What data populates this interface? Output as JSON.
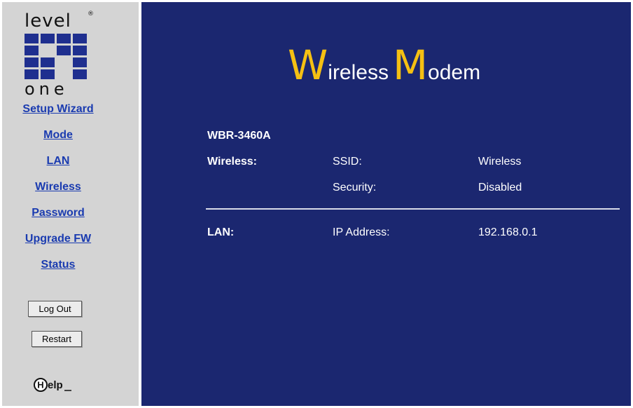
{
  "sidebar": {
    "logo": {
      "line1": "level",
      "registered": "®",
      "line2": "one"
    },
    "nav": [
      {
        "label": "Setup Wizard"
      },
      {
        "label": "Mode"
      },
      {
        "label": "LAN"
      },
      {
        "label": "Wireless"
      },
      {
        "label": "Password"
      },
      {
        "label": "Upgrade FW"
      },
      {
        "label": "Status"
      }
    ],
    "logout_label": "Log Out",
    "restart_label": "Restart",
    "help_label": "elp"
  },
  "main": {
    "title": {
      "w_cap": "W",
      "w_rest": "ireless",
      "m_cap": "M",
      "m_rest": "odem"
    },
    "model": "WBR-3460A",
    "wireless": {
      "label": "Wireless:",
      "ssid_label": "SSID:",
      "ssid_value": "Wireless",
      "security_label": "Security:",
      "security_value": "Disabled"
    },
    "lan": {
      "label": "LAN:",
      "ip_label": "IP Address:",
      "ip_value": "192.168.0.1"
    }
  },
  "colors": {
    "main_bg": "#1b2770",
    "sidebar_bg": "#d4d4d4",
    "accent": "#f5c013",
    "link": "#1a3bb0"
  }
}
